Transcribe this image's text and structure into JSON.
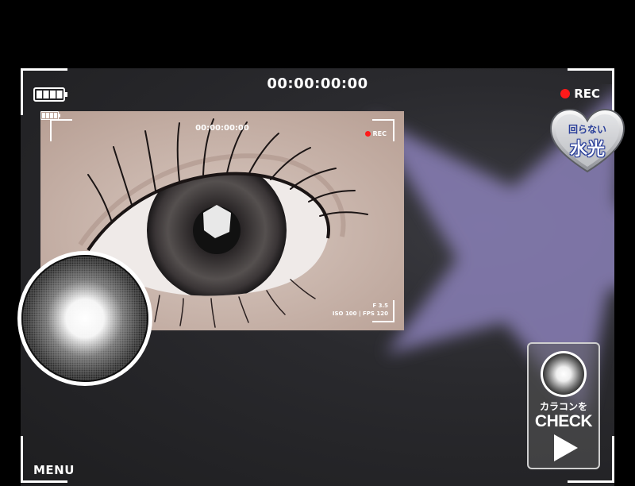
{
  "camera": {
    "timecode": "00:00:00:00",
    "rec_label": "REC",
    "menu_label": "MENU",
    "rec_color": "#ff1a1a"
  },
  "preview": {
    "timecode": "00:00:00:00",
    "rec_label": "REC",
    "aperture": "F 3.5",
    "iso_fps": "ISO 100 | FPS 120"
  },
  "badge": {
    "line1": "回らない",
    "line2": "水光",
    "icon": "heart-badge-icon",
    "text_color": "#2a3f9a"
  },
  "check_button": {
    "line1": "カラコンを",
    "line2": "CHECK",
    "icon": "play-icon"
  },
  "icons": [
    "battery-icon",
    "rec-dot-icon",
    "lens-icon",
    "star-shape"
  ],
  "colors": {
    "background": "#000000",
    "viewport": "#2a2a2e",
    "star": "#8a80b8"
  }
}
